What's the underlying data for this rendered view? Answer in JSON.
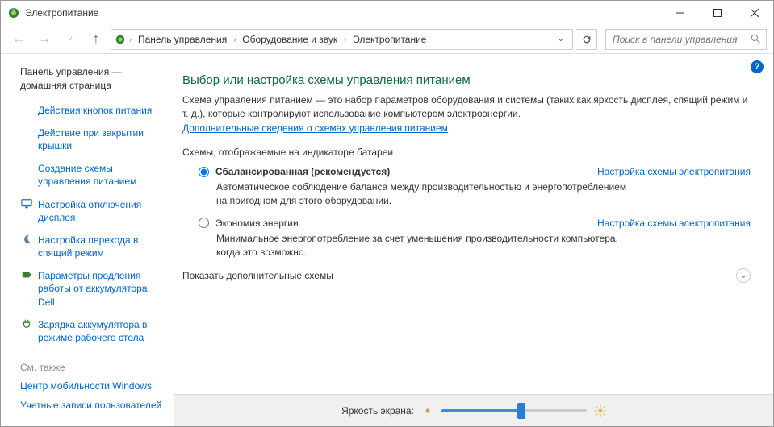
{
  "window": {
    "title": "Электропитание"
  },
  "breadcrumb": {
    "items": [
      "Панель управления",
      "Оборудование и звук",
      "Электропитание"
    ]
  },
  "search": {
    "placeholder": "Поиск в панели управления"
  },
  "sidebar": {
    "home": "Панель управления — домашняя страница",
    "links": [
      {
        "label": "Действия кнопок питания",
        "icon": null
      },
      {
        "label": "Действие при закрытии крышки",
        "icon": null
      },
      {
        "label": "Создание схемы управления питанием",
        "icon": null
      },
      {
        "label": "Настройка отключения дисплея",
        "icon": "monitor"
      },
      {
        "label": "Настройка перехода в спящий режим",
        "icon": "moon"
      },
      {
        "label": "Параметры продления работы от аккумулятора Dell",
        "icon": "battery"
      },
      {
        "label": "Зарядка аккумулятора в режиме рабочего стола",
        "icon": "plug"
      }
    ],
    "see_also_heading": "См. также",
    "see_also": [
      "Центр мобильности Windows",
      "Учетные записи пользователей"
    ]
  },
  "main": {
    "heading": "Выбор или настройка схемы управления питанием",
    "description": "Схема управления питанием — это набор параметров оборудования и системы (таких как яркость дисплея, спящий режим и т. д.), которые контролируют использование компьютером электроэнергии.",
    "more_link": "Дополнительные сведения о схемах управления питанием",
    "group_label": "Схемы, отображаемые на индикаторе батареи",
    "plans": [
      {
        "name": "Сбалансированная (рекомендуется)",
        "desc": "Автоматическое соблюдение баланса между производительностью и энергопотреблением на пригодном для этого оборудовании.",
        "config_link": "Настройка схемы электропитания",
        "selected": true
      },
      {
        "name": "Экономия энергии",
        "desc": "Минимальное энергопотребление за счет уменьшения производительности компьютера, когда это возможно.",
        "config_link": "Настройка схемы электропитания",
        "selected": false
      }
    ],
    "expander_label": "Показать дополнительные схемы",
    "brightness_label": "Яркость экрана:"
  },
  "chart_data": {
    "type": "slider",
    "min": 0,
    "max": 100,
    "value": 55
  }
}
